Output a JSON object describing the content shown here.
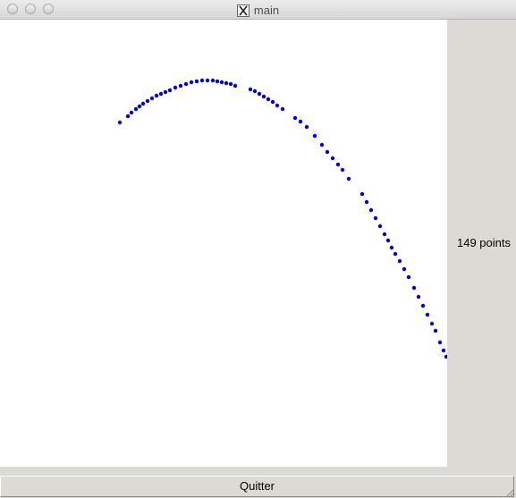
{
  "window": {
    "title": "main"
  },
  "side_panel": {
    "point_count_text": "149 points"
  },
  "buttons": {
    "quit_label": "Quitter"
  },
  "icons": {
    "title_icon": "x11-icon",
    "resize_grip": "resize-grip-icon"
  },
  "colors": {
    "points": "#0000e0",
    "canvas_bg": "#ffffff",
    "panel_bg": "#dcdad5"
  },
  "chart_data": {
    "type": "scatter",
    "x": [
      134,
      143,
      147,
      152,
      156,
      160,
      165,
      170,
      175,
      180,
      185,
      190,
      196,
      202,
      208,
      214,
      220,
      226,
      232,
      238,
      243,
      248,
      253,
      258,
      263,
      280,
      285,
      290,
      295,
      300,
      305,
      310,
      316,
      330,
      336,
      343,
      352,
      360,
      366,
      372,
      378,
      383,
      390,
      405,
      410,
      415,
      420,
      425,
      430,
      434,
      438,
      442,
      447,
      452,
      457,
      463,
      468,
      473,
      478,
      483,
      487,
      492,
      496,
      499
    ],
    "y": [
      115,
      108,
      104,
      100,
      97,
      94,
      91,
      88,
      85,
      83,
      81,
      79,
      76,
      74,
      72,
      70,
      69,
      68,
      68,
      68,
      69,
      70,
      71,
      72,
      74,
      78,
      80,
      83,
      86,
      89,
      92,
      96,
      100,
      110,
      114,
      120,
      130,
      140,
      148,
      155,
      162,
      168,
      178,
      195,
      204,
      213,
      222,
      231,
      240,
      247,
      255,
      262,
      270,
      279,
      288,
      300,
      310,
      320,
      330,
      340,
      348,
      361,
      370,
      377
    ]
  }
}
